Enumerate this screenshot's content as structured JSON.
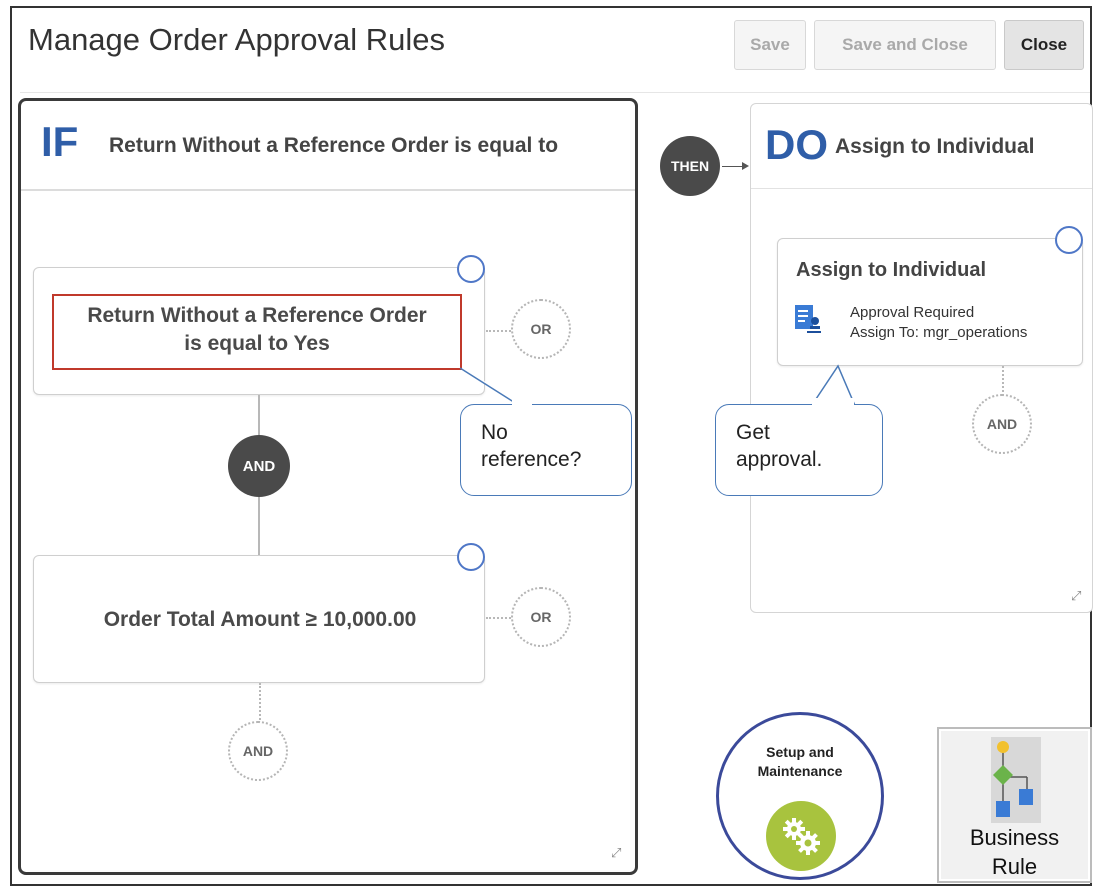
{
  "page": {
    "title": "Manage Order Approval Rules"
  },
  "toolbar": {
    "save": "Save",
    "save_and_close": "Save and Close",
    "close": "Close"
  },
  "if_panel": {
    "keyword": "IF",
    "header": "Return Without a Reference Order is equal to",
    "conditions": [
      {
        "line1": "Return Without a Reference Order",
        "line2": "is equal to Yes",
        "or_label": "OR"
      },
      {
        "line1": "Order Total Amount ≥ 10,000.00",
        "or_label": "OR"
      }
    ],
    "join_label": "AND",
    "add_and_label": "AND"
  },
  "connector": {
    "label": "THEN"
  },
  "do_panel": {
    "keyword": "DO",
    "header": "Assign to Individual",
    "action": {
      "title": "Assign to Individual",
      "detail1": "Approval Required",
      "detail2": "Assign To: mgr_operations"
    },
    "add_and_label": "AND"
  },
  "callouts": {
    "no_reference": {
      "line1": "No",
      "line2": "reference?"
    },
    "get_approval": {
      "line1": "Get",
      "line2": "approval."
    }
  },
  "setup_maintenance": {
    "line1": "Setup and",
    "line2": "Maintenance",
    "icon": "gears-icon",
    "color": "#a8c33e"
  },
  "business_rule": {
    "line1": "Business",
    "line2": "Rule",
    "icon": "business-rule-icon"
  },
  "colors": {
    "accent": "#2f5ea8",
    "selection": "#4f77c7",
    "highlight": "#c0392b",
    "connector": "#4a4a4a"
  }
}
